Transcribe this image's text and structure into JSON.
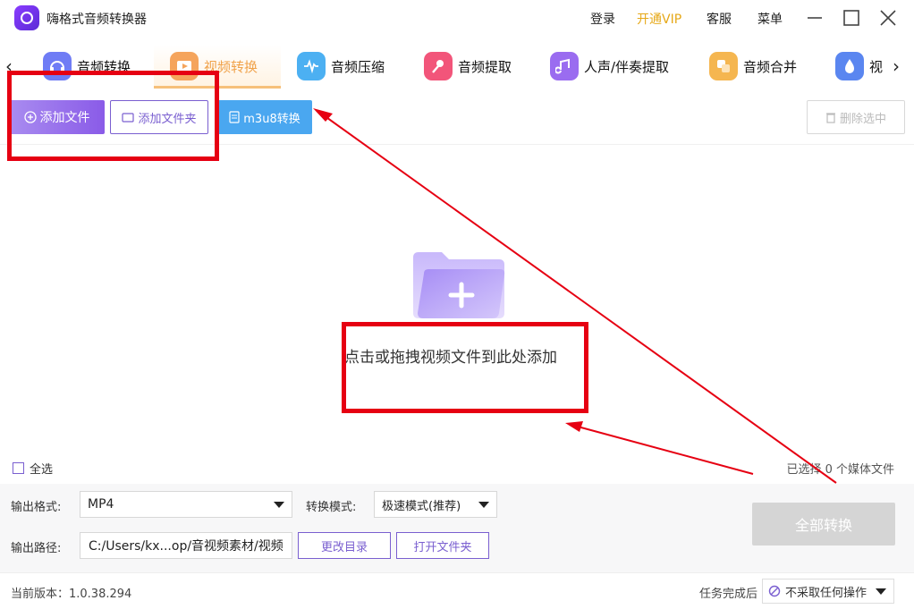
{
  "app": {
    "title": "嗨格式音频转换器",
    "links": [
      "登录",
      "开通VIP",
      "客服",
      "菜单"
    ],
    "vip_color": "#e6a817"
  },
  "tabs": [
    {
      "label": "音频转换",
      "icon": "headphones-icon",
      "color": "#6f7cf5"
    },
    {
      "label": "视频转换",
      "icon": "video-play-icon",
      "color": "#f5a45c",
      "active": true
    },
    {
      "label": "音频压缩",
      "icon": "waveform-icon",
      "color": "#4cb0f2"
    },
    {
      "label": "音频提取",
      "icon": "microphone-icon",
      "color": "#f2557a"
    },
    {
      "label": "人声/伴奏提取",
      "icon": "music-note-icon",
      "color": "#9a6cf0"
    },
    {
      "label": "音频合并",
      "icon": "merge-icon",
      "color": "#f5b650"
    },
    {
      "label": "视",
      "icon": "droplet-icon",
      "color": "#5a86f0"
    }
  ],
  "toolbar": {
    "add_file": "添加文件",
    "add_folder": "添加文件夹",
    "m3u8": "m3u8转换",
    "delete_selected": "删除选中"
  },
  "dropzone": {
    "hint": "点击或拖拽视频文件到此处添加"
  },
  "selection": {
    "select_all": "全选",
    "count_text": "已选择 0 个媒体文件"
  },
  "output": {
    "format_label": "输出格式:",
    "format_value": "MP4",
    "mode_label": "转换模式:",
    "mode_value": "极速模式(推荐)",
    "path_label": "输出路径:",
    "path_value": "C:/Users/kx...op/音视频素材/视频",
    "change_dir": "更改目录",
    "open_folder": "打开文件夹",
    "convert_all": "全部转换"
  },
  "status": {
    "version": "当前版本：1.0.38.294",
    "after_label": "任务完成后",
    "after_value": "不采取任何操作"
  },
  "colors": {
    "accent_purple": "#8a5be8",
    "m3u8_blue": "#4aa7f0",
    "annotation_red": "#e60012"
  }
}
